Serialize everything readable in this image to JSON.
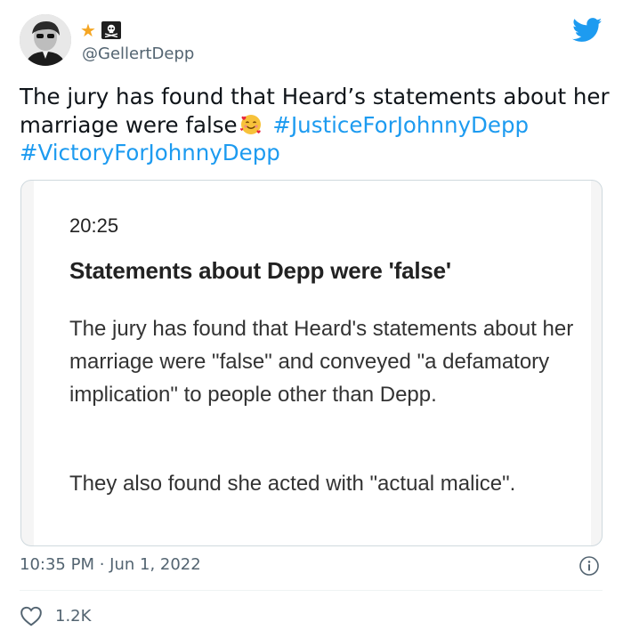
{
  "author": {
    "handle": "@GellertDepp",
    "badges": [
      "star-badge",
      "skull-crossbones-badge"
    ]
  },
  "tweet": {
    "text_part1": "The jury has found that Heard’s statements about her marriage were false",
    "emoji": "smiling-face-with-hearts",
    "hashtag1": "#JusticeForJohnnyDepp",
    "hashtag2": "#VictoryForJohnnyDepp"
  },
  "quote": {
    "time": "20:25",
    "headline": "Statements about Depp were 'false'",
    "paragraph1": "The jury has found that Heard's statements about her marriage were \"false\" and conveyed \"a defamatory implication\" to people other than Depp.",
    "paragraph2": "They also found she acted with \"actual malice\"."
  },
  "meta": {
    "timestamp": "10:35 PM · Jun 1, 2022"
  },
  "engagement": {
    "likes": "1.2K"
  },
  "colors": {
    "accent": "#1d9bf0",
    "secondary_text": "#536471",
    "border": "#cfd9de"
  },
  "icons": [
    "twitter-bird-icon",
    "info-icon",
    "heart-icon"
  ]
}
